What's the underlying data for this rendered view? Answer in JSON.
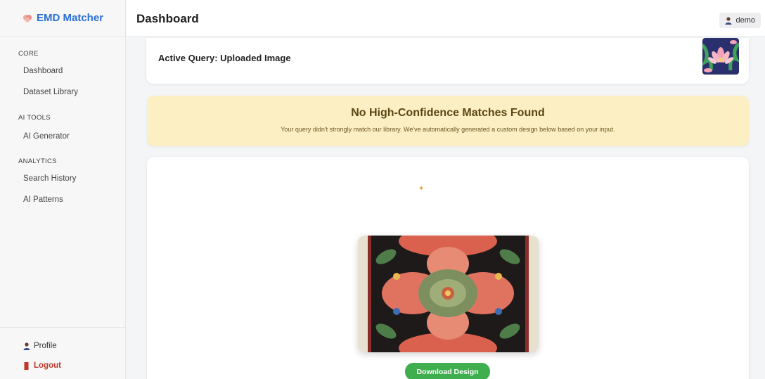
{
  "app": {
    "brand": "EMD Matcher",
    "brand_icon": "brain-icon",
    "accent": "#2a6fd6"
  },
  "sidebar": {
    "sections": [
      {
        "label": "CORE",
        "items": [
          {
            "label": "Dashboard"
          },
          {
            "label": "Dataset Library"
          }
        ]
      },
      {
        "label": "AI TOOLS",
        "items": [
          {
            "label": "AI Generator"
          }
        ]
      },
      {
        "label": "ANALYTICS",
        "items": [
          {
            "label": "Search History"
          },
          {
            "label": "AI Patterns"
          }
        ]
      }
    ],
    "footer": {
      "profile_label": "Profile",
      "profile_icon": "user-icon",
      "logout_label": "Logout",
      "logout_icon": "door-icon",
      "logout_color": "#c0392b"
    }
  },
  "header": {
    "title": "Dashboard",
    "user": "demo",
    "user_icon": "user-icon"
  },
  "query": {
    "title": "Active Query: Uploaded Image",
    "thumbnail": "lotus-pattern-thumbnail"
  },
  "alert": {
    "title": "No High-Confidence Matches Found",
    "message": "Your query didn't strongly match our library. We've automatically generated a custom design below based on your input.",
    "bg": "#fcefc4"
  },
  "result": {
    "sparkle_icon": "sparkle-icon",
    "image": "embroidered-floral-design",
    "download_label": "Download Design",
    "download_color": "#3fae4f"
  }
}
